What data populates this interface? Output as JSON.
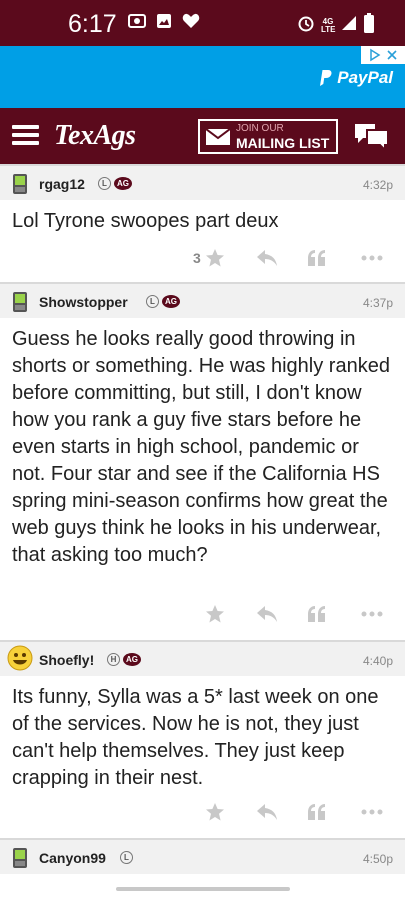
{
  "status_bar": {
    "time": "6:17",
    "network": "4G LTE",
    "left_icons": [
      "cast-icon",
      "image-icon",
      "heart-icon"
    ],
    "right_icons": [
      "alarm-icon",
      "signal-icon",
      "battery-icon"
    ]
  },
  "ad": {
    "brand": "PayPal",
    "colors": {
      "background": "#009fe6"
    }
  },
  "nav": {
    "logo": "TexAgs",
    "mailing_join": "JOIN OUR",
    "mailing_list": "MAILING LIST",
    "colors": {
      "bar": "#5b0a1c"
    }
  },
  "posts": [
    {
      "username": "rgag12",
      "badges": [
        "L",
        "AG"
      ],
      "time": "4:32p",
      "body": "Lol Tyrone swoopes part deux",
      "star_count": "3",
      "avatar": "phone-icon"
    },
    {
      "username": "Showstopper",
      "badges": [
        "L",
        "AG"
      ],
      "time": "4:37p",
      "body": "Guess he looks really good throwing in shorts or something. He was highly ranked before committing, but still, I don't know how you rank a guy five stars before he even starts in high school, pandemic or not. Four star and see if the California HS spring mini-season confirms how great the web guys think he looks in his underwear, that asking too much?",
      "avatar": "phone-icon"
    },
    {
      "username": "Shoefly!",
      "badges": [
        "H",
        "AG"
      ],
      "time": "4:40p",
      "body": "Its funny, Sylla was a 5* last week on one of the services. Now he is not, they just can't help themselves. They just keep crapping in their nest.",
      "avatar": "smiley-icon"
    },
    {
      "username": "Canyon99",
      "badges": [
        "L"
      ],
      "time": "4:50p",
      "avatar": "phone-icon"
    }
  ]
}
